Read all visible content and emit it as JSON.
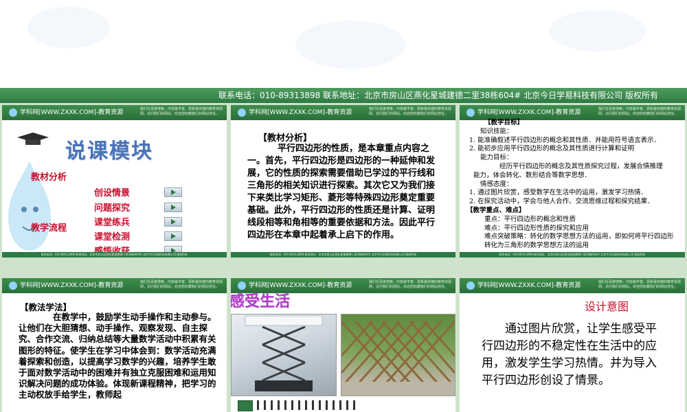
{
  "top": {
    "contact": "联系电话：010-89313898  联系地址：北京市房山区燕化星城建德二里38栋604#  北京今日学易科技有限公司  版权所有"
  },
  "slide_header": {
    "brand": "学科网[WWW.ZXXK.COM]-教育资源",
    "note": "我们在百度搜索，内容最丰富、更新最快捷的教育资源网，访问我们的网站，欢迎您收藏我们的网站地址。"
  },
  "slide_footer": "联系电话：010-89313898  联系地址：北京市房山区燕化星城建德二里38栋604#  北京今日学易科技有限公司  版权所有",
  "slide1": {
    "title": "说课模块",
    "left_label_1": "教材分析",
    "left_label_2": "教学流程",
    "items": [
      "创设情景",
      "问题探究",
      "课堂练兵",
      "课堂检测",
      "感悟收获"
    ]
  },
  "slide2": {
    "heading": "【教材分析】",
    "body": "平行四边形的性质，是本章重点内容之一。首先，平行四边形是四边形的一种延伸和发展，它的性质的探索需要借助已学过的平行线和三角形的相关知识进行探索。其次它又为我们接下来类比学习矩形、菱形等特殊四边形奠定重要基础。此外，平行四边形的性质还是计算、证明线段相等和角相等的重要依据和方法。因此平行四边形在本章中起着承上启下的作用。"
  },
  "slide3": {
    "lines": [
      "【教学目标】",
      "知识技能：",
      "1. 能准确叙述平行四边形的概念和其性质．并能用符号语言表示．",
      "2. 能初步应用平行四边形的概念及其性质进行计算和证明",
      "能力目标：",
      "经历平行四边形的概念及其性质探究过程，发展合情推理",
      "能力，体会转化、数形结合等数学思想．",
      "情感态度：",
      "1. 通过图片欣赏，感受数学在生活中的运用，激发学习热情．",
      "2. 在探究活动中，学会与他人合作、交流思维过程和探究结果．",
      "【教学重点、难点】",
      "重点：平行四边形的概念和性质",
      "难点：平行四边形性质的探究和应用",
      "难点突破策略：转化的数学思想方法的运用，即如何将平行四边形转化为三角形的数学思想方法的运用"
    ]
  },
  "slide4": {
    "heading": "【教法学法】",
    "body": "在教学中，鼓励学生动手操作和主动参与。让他们在大胆猜想、动手操作、观察发现、自主探究、合作交流、归纳总结等大量数学活动中积累有关图形的特征。使学生在学习中体会到：数学活动充满着探索和创造，以提高学习数学的兴趣，培养学生敢于面对数学活动中的困难并有独立克服困难和运用知识解决问题的成功体验。体现新课程精神，把学习的主动权放手给学生，教师起"
  },
  "slide5": {
    "title": "感受生活"
  },
  "slide6": {
    "title": "设计意图",
    "body": "通过图片欣赏，让学生感受平行四边形的不稳定性在生活中的应用，激发学生学习热情。并为导入平行四边形创设了情景。"
  },
  "colors": {
    "header_green": "#2f7a44",
    "accent_red": "#c8102e",
    "title_blue": "#4a73b8"
  }
}
